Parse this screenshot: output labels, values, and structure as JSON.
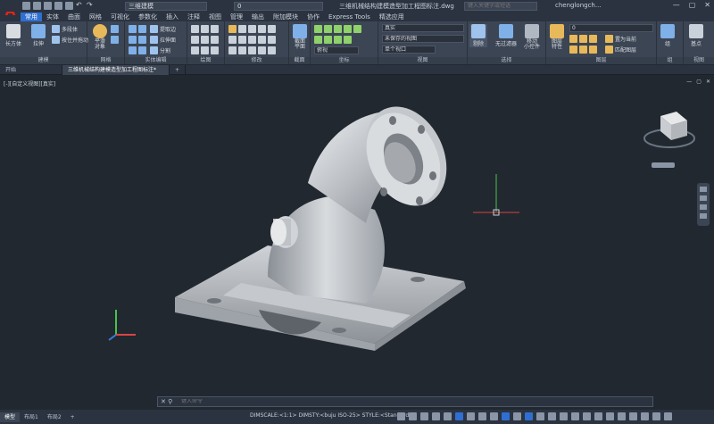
{
  "app": {
    "logo": "A"
  },
  "quick_access": {
    "workspace": "三维建模",
    "layer_value": "0"
  },
  "title": {
    "document": "三维机械结构建模造型加工程图标注.dwg"
  },
  "search": {
    "placeholder": "键入关键字或短语"
  },
  "user": {
    "name": "chenglongch..."
  },
  "window_controls": {
    "minimize": "—",
    "restore": "▢",
    "close": "✕"
  },
  "ribbon_tabs": [
    "常用",
    "实体",
    "曲面",
    "网格",
    "可视化",
    "参数化",
    "插入",
    "注释",
    "视图",
    "管理",
    "输出",
    "附加模块",
    "协作",
    "Express Tools",
    "精选应用"
  ],
  "ribbon": {
    "modeling": {
      "box": "长方体",
      "extrude": "拉伸",
      "polysolid": "多段体",
      "presspull": "按住并拖动",
      "label": "建模"
    },
    "mesh": {
      "smooth": "平滑\n对象",
      "label": "网格"
    },
    "solid_edit": {
      "extract": "提取边",
      "extrude_face": "拉伸面",
      "separate": "分割",
      "label": "实体编辑"
    },
    "draw": {
      "label": "绘图"
    },
    "modify": {
      "label": "修改"
    },
    "section": {
      "plane": "截面\n平面",
      "label": "截面"
    },
    "coordinates": {
      "label": "坐标"
    },
    "view": {
      "style": "真实",
      "saved": "未保存的视图",
      "plan": "俯视",
      "viewport": "单个视口",
      "label": "视图"
    },
    "selection": {
      "cull": "剔除",
      "nofilter": "无过滤器",
      "gizmo": "移动\n小控件",
      "label": "选择"
    },
    "layers": {
      "layer": "图层\n特性",
      "value": "0",
      "make_current": "置为当前",
      "match": "匹配图层",
      "label": "图层"
    },
    "groups": {
      "group": "组",
      "label": "组"
    },
    "views_panel": {
      "base": "基点",
      "label": "视图"
    }
  },
  "file_tabs": {
    "start": "开始",
    "doc": "三维机械结构建模造型加工程图标注*",
    "add": "+"
  },
  "viewport": {
    "label": "[-][自定义视图][真实]",
    "controls": [
      "—",
      "▢",
      "✕"
    ]
  },
  "cmdline": {
    "placeholder": "键入命令"
  },
  "status": {
    "tabs": [
      "模型",
      "布局1",
      "布局2"
    ],
    "dimscale": "DIMSCALE:<1:1> DIMSTY:<buju ISO-25> STYLE:<Standard>"
  },
  "colors": {
    "accent": "#2f6fd1",
    "background": "#212830",
    "brand": "#e2231a"
  },
  "icons": [
    "app-logo-icon",
    "new-icon",
    "open-icon",
    "save-icon",
    "undo-icon",
    "redo-icon",
    "search-icon",
    "user-icon",
    "viewcube-icon",
    "navbar-icon",
    "ucs-icon"
  ]
}
